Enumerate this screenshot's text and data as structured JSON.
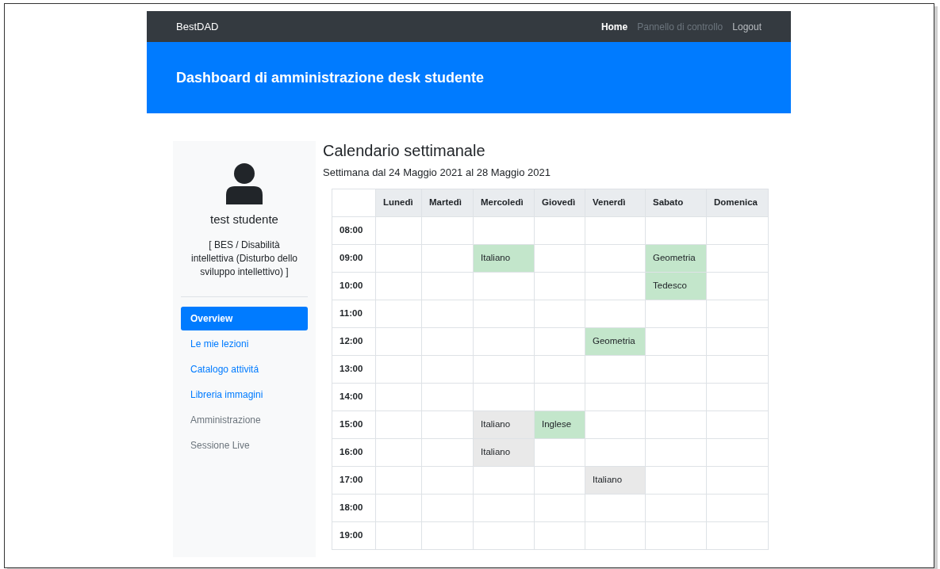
{
  "navbar": {
    "brand": "BestDAD",
    "links": [
      {
        "label": "Home",
        "selected": true,
        "disabled": false
      },
      {
        "label": "Pannello di controllo",
        "selected": false,
        "disabled": true
      },
      {
        "label": "Logout",
        "selected": false,
        "disabled": false
      }
    ]
  },
  "header": {
    "title": "Dashboard di amministrazione desk studente"
  },
  "sidebar": {
    "user_name": "test studente",
    "user_info": "[ BES / Disabilità intellettiva (Disturbo dello sviluppo intellettivo) ]",
    "items": [
      {
        "label": "Overview",
        "selected": true,
        "disabled": false
      },
      {
        "label": "Le mie lezioni",
        "selected": false,
        "disabled": false
      },
      {
        "label": "Catalogo attivitá",
        "selected": false,
        "disabled": false
      },
      {
        "label": "Libreria immagini",
        "selected": false,
        "disabled": false
      },
      {
        "label": "Amministrazione",
        "selected": false,
        "disabled": true
      },
      {
        "label": "Sessione Live",
        "selected": false,
        "disabled": true
      }
    ]
  },
  "calendar": {
    "title": "Calendario settimanale",
    "subtitle": "Settimana dal 24 Maggio 2021 al 28 Maggio 2021",
    "columns": [
      "Lunedì",
      "Martedì",
      "Mercoledì",
      "Giovedì",
      "Venerdì",
      "Sabato",
      "Domenica"
    ],
    "rows": [
      {
        "time": "08:00",
        "cells": [
          {},
          {},
          {},
          {},
          {},
          {},
          {}
        ]
      },
      {
        "time": "09:00",
        "cells": [
          {},
          {},
          {
            "subject": "Italiano",
            "color": "#c3e6cb"
          },
          {},
          {},
          {
            "subject": "Geometria",
            "color": "#c3e6cb"
          },
          {}
        ]
      },
      {
        "time": "10:00",
        "cells": [
          {},
          {},
          {},
          {},
          {},
          {
            "subject": "Tedesco",
            "color": "#c3e6cb"
          },
          {}
        ]
      },
      {
        "time": "11:00",
        "cells": [
          {},
          {},
          {},
          {},
          {},
          {},
          {}
        ]
      },
      {
        "time": "12:00",
        "cells": [
          {},
          {},
          {},
          {},
          {
            "subject": "Geometria",
            "color": "#c3e6cb"
          },
          {},
          {}
        ]
      },
      {
        "time": "13:00",
        "cells": [
          {},
          {},
          {},
          {},
          {},
          {},
          {}
        ]
      },
      {
        "time": "14:00",
        "cells": [
          {},
          {},
          {},
          {},
          {},
          {},
          {}
        ]
      },
      {
        "time": "15:00",
        "cells": [
          {},
          {},
          {
            "subject": "Italiano",
            "color": "#e9e9e9"
          },
          {
            "subject": "Inglese",
            "color": "#c3e6cb"
          },
          {},
          {},
          {}
        ]
      },
      {
        "time": "16:00",
        "cells": [
          {},
          {},
          {
            "subject": "Italiano",
            "color": "#e9e9e9"
          },
          {},
          {},
          {},
          {}
        ]
      },
      {
        "time": "17:00",
        "cells": [
          {},
          {},
          {},
          {},
          {
            "subject": "Italiano",
            "color": "#e9e9e9"
          },
          {},
          {}
        ]
      },
      {
        "time": "18:00",
        "cells": [
          {},
          {},
          {},
          {},
          {},
          {},
          {}
        ]
      },
      {
        "time": "19:00",
        "cells": [
          {},
          {},
          {},
          {},
          {},
          {},
          {}
        ]
      }
    ]
  }
}
